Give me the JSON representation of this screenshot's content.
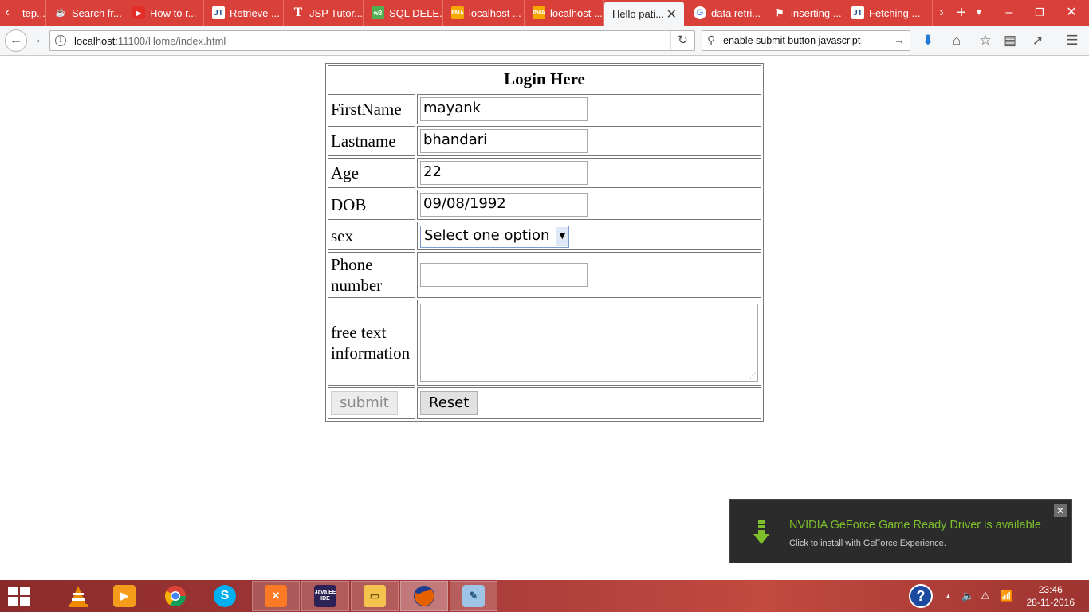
{
  "browser": {
    "tabs": [
      {
        "title": "tep...",
        "icon": "page-icon"
      },
      {
        "title": "Search fr...",
        "icon": "java-icon"
      },
      {
        "title": "How to r...",
        "icon": "youtube-icon"
      },
      {
        "title": "Retrieve ...",
        "icon": "javatpoint-icon"
      },
      {
        "title": "JSP Tutor...",
        "icon": "tutorial-icon"
      },
      {
        "title": "SQL DELE...",
        "icon": "w3schools-icon"
      },
      {
        "title": "localhost ...",
        "icon": "phpmyadmin-icon"
      },
      {
        "title": "localhost ...",
        "icon": "phpmyadmin-icon"
      },
      {
        "title": "Hello pati...",
        "icon": "",
        "active": true
      },
      {
        "title": "data retri...",
        "icon": "google-icon"
      },
      {
        "title": "inserting ...",
        "icon": "stackoverflow-icon"
      },
      {
        "title": "Fetching ...",
        "icon": "javatpoint-icon"
      }
    ],
    "url_host": "localhost",
    "url_rest": ":11100/Home/index.html",
    "search_text": "enable submit button javascript"
  },
  "form": {
    "heading": "Login Here",
    "firstname_label": "FirstName",
    "firstname_value": "mayank",
    "lastname_label": "Lastname",
    "lastname_value": "bhandari",
    "age_label": "Age",
    "age_value": "22",
    "dob_label": "DOB",
    "dob_value": "09/08/1992",
    "sex_label": "sex",
    "sex_selected": "Select one option",
    "phone_label_line1": "Phone",
    "phone_label_line2": "number",
    "phone_value": "",
    "freetext_label_line1": "free text",
    "freetext_label_line2": "information",
    "submit_label": "submit",
    "reset_label": "Reset"
  },
  "notification": {
    "title": "NVIDIA GeForce Game Ready Driver is available",
    "subtitle": "Click to install with GeForce Experience."
  },
  "taskbar": {
    "apps": [
      "vlc-icon",
      "media-player-icon",
      "chrome-icon",
      "skype-icon",
      "xampp-icon",
      "java-ee-ide-icon",
      "file-explorer-icon",
      "firefox-icon",
      "notepad-icon"
    ],
    "time": "23:46",
    "date": "28-11-2016"
  },
  "colors": {
    "tabstrip": "#d9403a",
    "notification_accent": "#7fbf2c"
  }
}
